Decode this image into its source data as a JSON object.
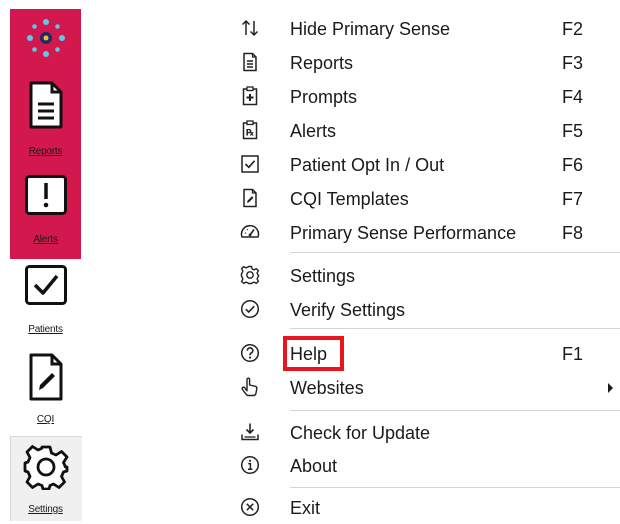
{
  "toolbar": {
    "buttons": [
      {
        "name": "primary-sense",
        "label": "",
        "icon": "dots-logo-icon"
      },
      {
        "name": "reports",
        "label": "Reports",
        "icon": "document-icon"
      },
      {
        "name": "alerts",
        "label": "Alerts",
        "icon": "exclamation-icon"
      },
      {
        "name": "patients",
        "label": "Patients",
        "icon": "checkbox-icon"
      },
      {
        "name": "cqi",
        "label": "CQI",
        "icon": "pencil-document-icon"
      },
      {
        "name": "settings",
        "label": "Settings",
        "icon": "gear-icon"
      }
    ],
    "active_color": "#d3184e"
  },
  "menu": {
    "items": [
      {
        "label": "Hide Primary Sense",
        "shortcut": "F2",
        "icon": "up-down-arrows-icon"
      },
      {
        "label": "Reports",
        "shortcut": "F3",
        "icon": "document-icon"
      },
      {
        "label": "Prompts",
        "shortcut": "F4",
        "icon": "clipboard-plus-icon"
      },
      {
        "label": "Alerts",
        "shortcut": "F5",
        "icon": "prescription-icon"
      },
      {
        "label": "Patient Opt In / Out",
        "shortcut": "F6",
        "icon": "checkbox-icon"
      },
      {
        "label": "CQI Templates",
        "shortcut": "F7",
        "icon": "pencil-document-icon"
      },
      {
        "label": "Primary Sense Performance",
        "shortcut": "F8",
        "icon": "gauge-icon"
      },
      {
        "label": "Settings",
        "shortcut": "",
        "icon": "gear-icon"
      },
      {
        "label": "Verify Settings",
        "shortcut": "",
        "icon": "check-circle-icon"
      },
      {
        "label": "Help",
        "shortcut": "F1",
        "icon": "question-circle-icon"
      },
      {
        "label": "Websites",
        "shortcut": "",
        "icon": "pointing-hand-icon",
        "submenu": true
      },
      {
        "label": "Check for Update",
        "shortcut": "",
        "icon": "download-icon"
      },
      {
        "label": "About",
        "shortcut": "",
        "icon": "info-circle-icon"
      },
      {
        "label": "Exit",
        "shortcut": "",
        "icon": "close-circle-icon"
      }
    ],
    "highlighted": "Help",
    "highlight_color": "#e8151d"
  }
}
